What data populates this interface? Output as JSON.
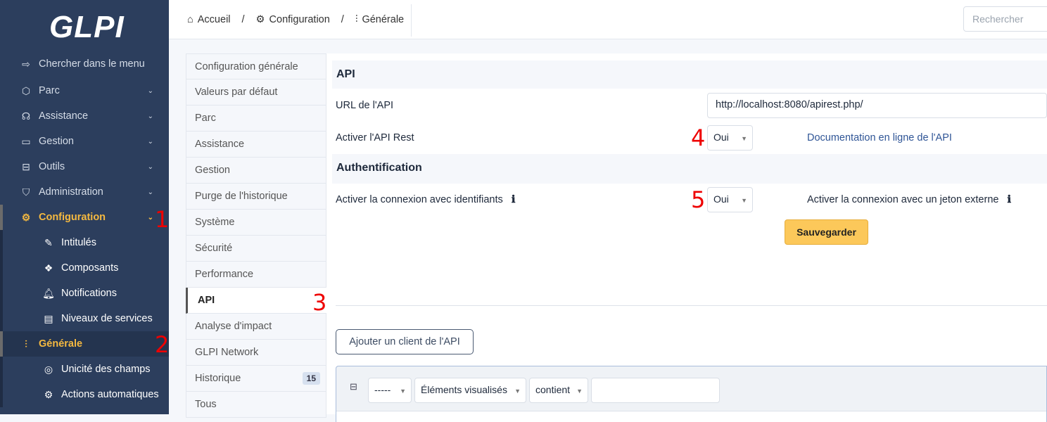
{
  "sidebar": {
    "logo": "GLPI",
    "search": "Chercher dans le menu",
    "items": [
      {
        "label": "Parc",
        "icon": "box-icon"
      },
      {
        "label": "Assistance",
        "icon": "headset-icon"
      },
      {
        "label": "Gestion",
        "icon": "wallet-icon"
      },
      {
        "label": "Outils",
        "icon": "briefcase-icon"
      },
      {
        "label": "Administration",
        "icon": "shield-icon"
      },
      {
        "label": "Configuration",
        "icon": "gear-icon",
        "active": true
      }
    ],
    "subitems": [
      {
        "label": "Intitulés"
      },
      {
        "label": "Composants"
      },
      {
        "label": "Notifications"
      },
      {
        "label": "Niveaux de services"
      },
      {
        "label": "Générale",
        "active": true
      },
      {
        "label": "Unicité des champs"
      },
      {
        "label": "Actions automatiques"
      }
    ]
  },
  "header": {
    "breadcrumb": [
      "Accueil",
      "Configuration",
      "Générale"
    ],
    "search_placeholder": "Rechercher"
  },
  "tabs": [
    {
      "label": "Configuration générale"
    },
    {
      "label": "Valeurs par défaut"
    },
    {
      "label": "Parc"
    },
    {
      "label": "Assistance"
    },
    {
      "label": "Gestion"
    },
    {
      "label": "Purge de l'historique"
    },
    {
      "label": "Système"
    },
    {
      "label": "Sécurité"
    },
    {
      "label": "Performance"
    },
    {
      "label": "API",
      "active": true
    },
    {
      "label": "Analyse d'impact"
    },
    {
      "label": "GLPI Network"
    },
    {
      "label": "Historique",
      "badge": "15"
    },
    {
      "label": "Tous"
    }
  ],
  "api": {
    "section_title": "API",
    "url_label": "URL de l'API",
    "url_value": "http://localhost:8080/apirest.php/",
    "rest_label": "Activer l'API Rest",
    "rest_value": "Oui",
    "doc_link": "Documentation en ligne de l'API",
    "auth_title": "Authentification",
    "login_label": "Activer la connexion avec identifiants",
    "login_value": "Oui",
    "token_label": "Activer la connexion avec un jeton externe",
    "save": "Sauvegarder",
    "add_client": "Ajouter un client de l'API"
  },
  "filter": {
    "field1": "-----",
    "field2": "Éléments visualisés",
    "field3": "contient",
    "value": ""
  },
  "annotations": [
    "1",
    "2",
    "3",
    "4",
    "5"
  ],
  "colors": {
    "sidebar": "#2c3e5d",
    "active": "#f5b940",
    "save": "#fcc85a",
    "annotation": "#ee0000"
  }
}
